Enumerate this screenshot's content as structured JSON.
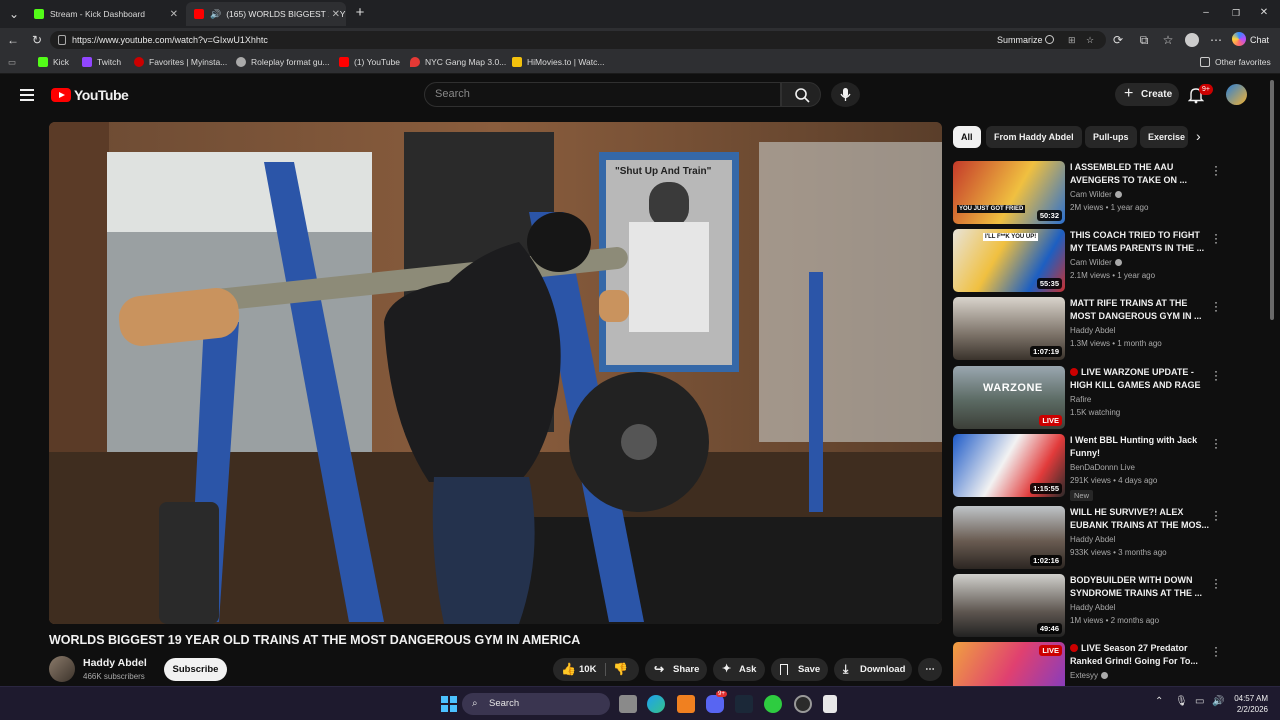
{
  "browser": {
    "tabs": [
      {
        "title": "Stream - Kick Dashboard",
        "icon": "kick-icon",
        "color": "#53fc18"
      },
      {
        "title": "(165) WORLDS BIGGEST 19 YE",
        "icon": "youtube-icon",
        "color": "#ff0000"
      }
    ],
    "url": "https://www.youtube.com/watch?v=GIxwU1Xhhtc",
    "summarize_label": "Summarize",
    "chat_label": "Chat",
    "bookmarks": [
      {
        "label": "Kick",
        "color": "#53fc18"
      },
      {
        "label": "Twitch",
        "color": "#9146ff"
      },
      {
        "label": "Favorites | Myinsta...",
        "color": "#cc0000"
      },
      {
        "label": "Roleplay format gu...",
        "color": "#aaaaaa"
      },
      {
        "label": "(1) YouTube",
        "color": "#ff0000"
      },
      {
        "label": "NYC Gang Map 3.0...",
        "color": "#e53935"
      },
      {
        "label": "HiMovies.to | Watc...",
        "color": "#f4c20d"
      }
    ],
    "other_favorites": "Other favorites"
  },
  "youtube": {
    "logo_text": "YouTube",
    "search_placeholder": "Search",
    "create_label": "Create",
    "notif_count": "9+",
    "video": {
      "title": "WORLDS BIGGEST 19 YEAR OLD TRAINS AT THE MOST DANGEROUS GYM IN AMERICA",
      "poster_text": "\"Shut Up And Train\"",
      "channel": "Haddy Abdel",
      "subscribers": "466K subscribers",
      "subscribe_label": "Subscribe",
      "likes": "10K",
      "share_label": "Share",
      "ask_label": "Ask",
      "save_label": "Save",
      "download_label": "Download"
    },
    "chips": [
      "All",
      "From Haddy Abdel",
      "Pull-ups",
      "Exercise"
    ],
    "recommendations": [
      {
        "title": "I ASSEMBLED THE AAU AVENGERS TO TAKE ON ...",
        "channel": "Cam Wilder",
        "verified": true,
        "meta": "2M views • 1 year ago",
        "duration": "50:32",
        "thumb_text": "YOU JUST GOT FRIED"
      },
      {
        "title": "THIS COACH TRIED TO FIGHT MY TEAMS PARENTS IN THE ...",
        "channel": "Cam Wilder",
        "verified": true,
        "meta": "2.1M views • 1 year ago",
        "duration": "55:35",
        "thumb_text": "I'LL F**K YOU UP!"
      },
      {
        "title": "MATT RIFE TRAINS AT THE MOST DANGEROUS GYM IN ...",
        "channel": "Haddy Abdel",
        "verified": false,
        "meta": "1.3M views • 1 month ago",
        "duration": "1:07:19",
        "thumb_text": ""
      },
      {
        "title": "LIVE WARZONE UPDATE - HIGH KILL GAMES AND RAGE ...",
        "channel": "Rafire",
        "verified": false,
        "meta": "1.5K watching",
        "duration": "LIVE",
        "live": true,
        "thumb_text": "WARZONE"
      },
      {
        "title": "I Went BBL Hunting with Jack Funny!",
        "channel": "BenDaDonnn Live",
        "verified": false,
        "meta": "291K views • 4 days ago",
        "duration": "1:15:55",
        "new_badge": "New",
        "thumb_text": ""
      },
      {
        "title": "WILL HE SURVIVE?! ALEX EUBANK TRAINS AT THE MOS...",
        "channel": "Haddy Abdel",
        "verified": false,
        "meta": "933K views • 3 months ago",
        "duration": "1:02:16",
        "thumb_text": ""
      },
      {
        "title": "BODYBUILDER WITH DOWN SYNDROME TRAINS AT THE ...",
        "channel": "Haddy Abdel",
        "verified": false,
        "meta": "1M views • 2 months ago",
        "duration": "49:46",
        "thumb_text": ""
      },
      {
        "title": "LIVE Season 27 Predator Ranked Grind! Going For To...",
        "channel": "Extesyy",
        "verified": true,
        "meta": "",
        "duration": "LIVE",
        "live": true,
        "thumb_text": ""
      }
    ]
  },
  "taskbar": {
    "search_label": "Search",
    "time": "04:57 AM",
    "date": "2/2/2026",
    "discord_badge": "9+"
  }
}
